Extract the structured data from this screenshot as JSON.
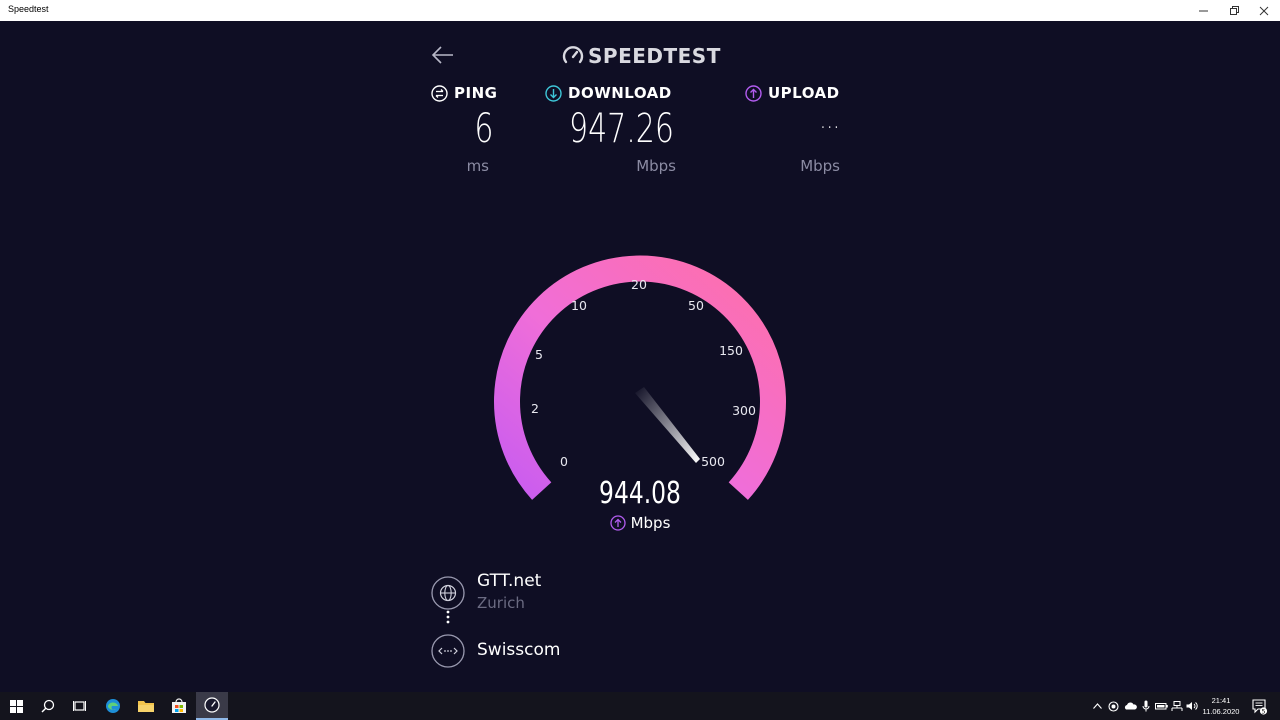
{
  "window": {
    "title": "Speedtest",
    "controls": [
      "—",
      "❐",
      "✕"
    ]
  },
  "header": {
    "logo_text": "SPEEDTEST"
  },
  "metrics": {
    "ping": {
      "label": "PING",
      "value": "6",
      "unit": "ms"
    },
    "download": {
      "label": "DOWNLOAD",
      "value": "947.26",
      "unit": "Mbps"
    },
    "upload": {
      "label": "UPLOAD",
      "value": "...",
      "unit": "Mbps"
    }
  },
  "gauge": {
    "scale_labels": [
      "0",
      "2",
      "5",
      "10",
      "20",
      "50",
      "150",
      "300",
      "500"
    ],
    "current_value": "944.08",
    "current_unit": "Mbps",
    "colors": {
      "start": "#c85cf0",
      "mid": "#ff70c8",
      "end": "#ff6fa0"
    }
  },
  "server": {
    "name": "GTT.net",
    "location": "Zurich"
  },
  "isp": {
    "name": "Swisscom"
  },
  "taskbar": {
    "clock_time": "21:41",
    "clock_date": "11.06.2020",
    "notification_count": "5"
  },
  "colors": {
    "background": "#0f0e24",
    "download_accent": "#3ec6d8",
    "upload_accent": "#b25cf0"
  }
}
